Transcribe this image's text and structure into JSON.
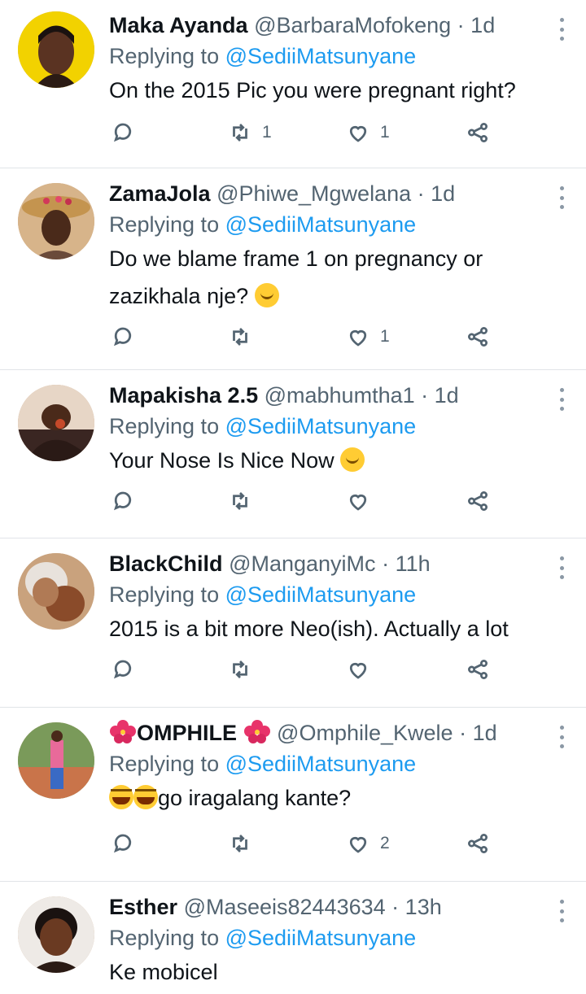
{
  "replying_prefix": "Replying to",
  "tweets": [
    {
      "name": "Maka Ayanda",
      "handle": "@BarbaraMofokeng",
      "time": "1d",
      "replying_to": "@SediiMatsunyane",
      "text": "On the 2015 Pic you were pregnant right?",
      "retweets": "1",
      "likes": "1",
      "avatar_color": "#e9c400"
    },
    {
      "name": "ZamaJola",
      "handle": "@Phiwe_Mgwelana",
      "time": "1d",
      "replying_to": "@SediiMatsunyane",
      "text": "Do we blame frame 1 on pregnancy or zazikhala nje?",
      "retweets": "",
      "likes": "1",
      "avatar_color": "#a0704f"
    },
    {
      "name": "Mapakisha 2.5",
      "handle": "@mabhumtha1",
      "time": "1d",
      "replying_to": "@SediiMatsunyane",
      "text": "Your Nose Is Nice Now",
      "retweets": "",
      "likes": "",
      "avatar_color": "#c77a55"
    },
    {
      "name": "BlackChild",
      "handle": "@ManganyiMc",
      "time": "11h",
      "replying_to": "@SediiMatsunyane",
      "text": "2015 is a bit more Neo(ish). Actually a lot",
      "retweets": "",
      "likes": "",
      "avatar_color": "#c9a27d"
    },
    {
      "name": "OMPHILE",
      "handle": "@Omphile_Kwele",
      "time": "1d",
      "replying_to": "@SediiMatsunyane",
      "text": "go iragalang kante?",
      "retweets": "",
      "likes": "2",
      "avatar_color": "#6b8f4e"
    },
    {
      "name": "Esther",
      "handle": "@Maseeis82443634",
      "time": "13h",
      "replying_to": "@SediiMatsunyane",
      "text": "Ke mobicel",
      "retweets": "",
      "likes": "",
      "avatar_color": "#d9c8b8"
    }
  ],
  "colors": {
    "accent": "#1d9bf0",
    "muted": "#536471",
    "divider": "#e1e4e8"
  },
  "icons": [
    "reply-icon",
    "retweet-icon",
    "like-icon",
    "share-icon",
    "more-icon"
  ]
}
